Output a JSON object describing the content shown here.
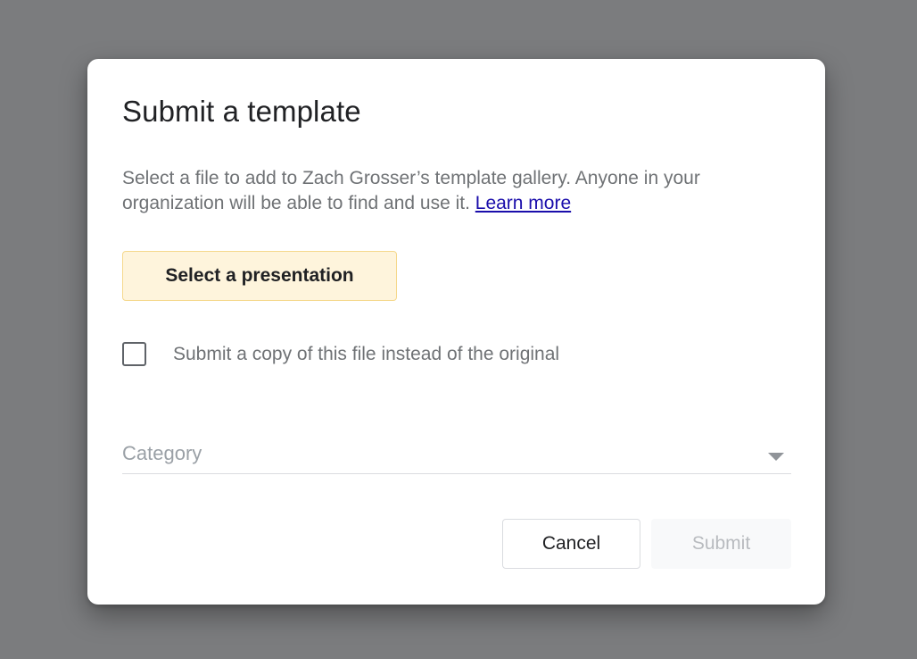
{
  "dialog": {
    "title": "Submit a template",
    "description": "Select a file to add to Zach Grosser’s template gallery. Anyone in your organization will be able to find and use it.",
    "learn_more": "Learn more",
    "select_button": "Select a presentation",
    "checkbox": {
      "label": "Submit a copy of this file instead of the original",
      "checked": false
    },
    "category": {
      "placeholder": "Category",
      "caret_icon": "dropdown-caret-icon"
    },
    "cancel_button": "Cancel",
    "submit_button": "Submit",
    "submit_enabled": false
  },
  "colors": {
    "overlay": "#7b7c7e",
    "select_button_bg": "#fef4dc",
    "select_button_border": "#f5d88c",
    "link": "#1a0dab"
  }
}
